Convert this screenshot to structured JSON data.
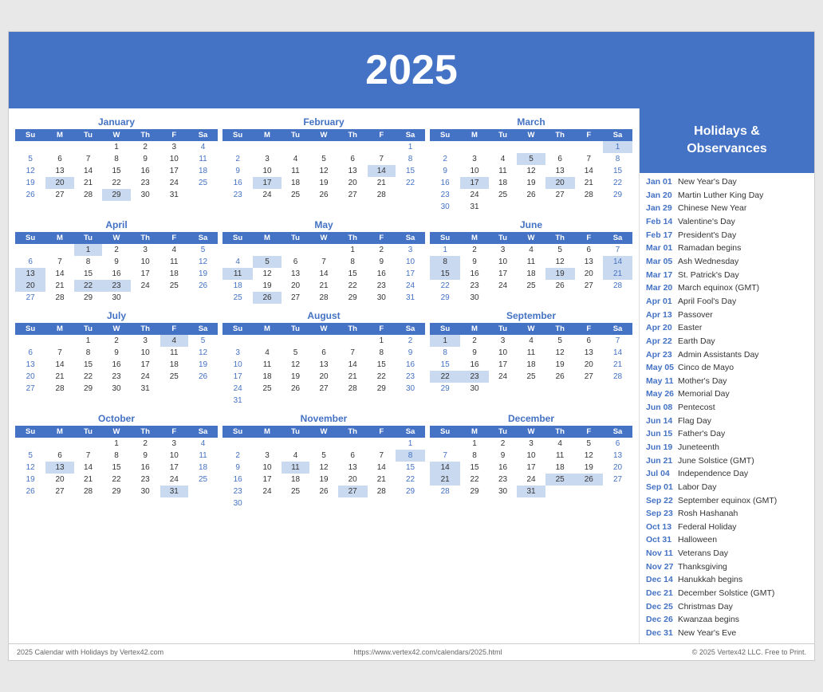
{
  "header": {
    "year": "2025"
  },
  "holidays_header": "Holidays &\nObservances",
  "holidays": [
    {
      "date": "Jan 01",
      "name": "New Year's Day"
    },
    {
      "date": "Jan 20",
      "name": "Martin Luther King Day"
    },
    {
      "date": "Jan 29",
      "name": "Chinese New Year"
    },
    {
      "date": "Feb 14",
      "name": "Valentine's Day"
    },
    {
      "date": "Feb 17",
      "name": "President's Day"
    },
    {
      "date": "Mar 01",
      "name": "Ramadan begins"
    },
    {
      "date": "Mar 05",
      "name": "Ash Wednesday"
    },
    {
      "date": "Mar 17",
      "name": "St. Patrick's Day"
    },
    {
      "date": "Mar 20",
      "name": "March equinox (GMT)"
    },
    {
      "date": "Apr 01",
      "name": "April Fool's Day"
    },
    {
      "date": "Apr 13",
      "name": "Passover"
    },
    {
      "date": "Apr 20",
      "name": "Easter"
    },
    {
      "date": "Apr 22",
      "name": "Earth Day"
    },
    {
      "date": "Apr 23",
      "name": "Admin Assistants Day"
    },
    {
      "date": "May 05",
      "name": "Cinco de Mayo"
    },
    {
      "date": "May 11",
      "name": "Mother's Day"
    },
    {
      "date": "May 26",
      "name": "Memorial Day"
    },
    {
      "date": "Jun 08",
      "name": "Pentecost"
    },
    {
      "date": "Jun 14",
      "name": "Flag Day"
    },
    {
      "date": "Jun 15",
      "name": "Father's Day"
    },
    {
      "date": "Jun 19",
      "name": "Juneteenth"
    },
    {
      "date": "Jun 21",
      "name": "June Solstice (GMT)"
    },
    {
      "date": "Jul 04",
      "name": "Independence Day"
    },
    {
      "date": "Sep 01",
      "name": "Labor Day"
    },
    {
      "date": "Sep 22",
      "name": "September equinox (GMT)"
    },
    {
      "date": "Sep 23",
      "name": "Rosh Hashanah"
    },
    {
      "date": "Oct 13",
      "name": "Federal Holiday"
    },
    {
      "date": "Oct 31",
      "name": "Halloween"
    },
    {
      "date": "Nov 11",
      "name": "Veterans Day"
    },
    {
      "date": "Nov 27",
      "name": "Thanksgiving"
    },
    {
      "date": "Dec 14",
      "name": "Hanukkah begins"
    },
    {
      "date": "Dec 21",
      "name": "December Solstice (GMT)"
    },
    {
      "date": "Dec 25",
      "name": "Christmas Day"
    },
    {
      "date": "Dec 26",
      "name": "Kwanzaa begins"
    },
    {
      "date": "Dec 31",
      "name": "New Year's Eve"
    }
  ],
  "footer": {
    "left": "2025 Calendar with Holidays by Vertex42.com",
    "center": "https://www.vertex42.com/calendars/2025.html",
    "right": "© 2025 Vertex42 LLC. Free to Print."
  }
}
